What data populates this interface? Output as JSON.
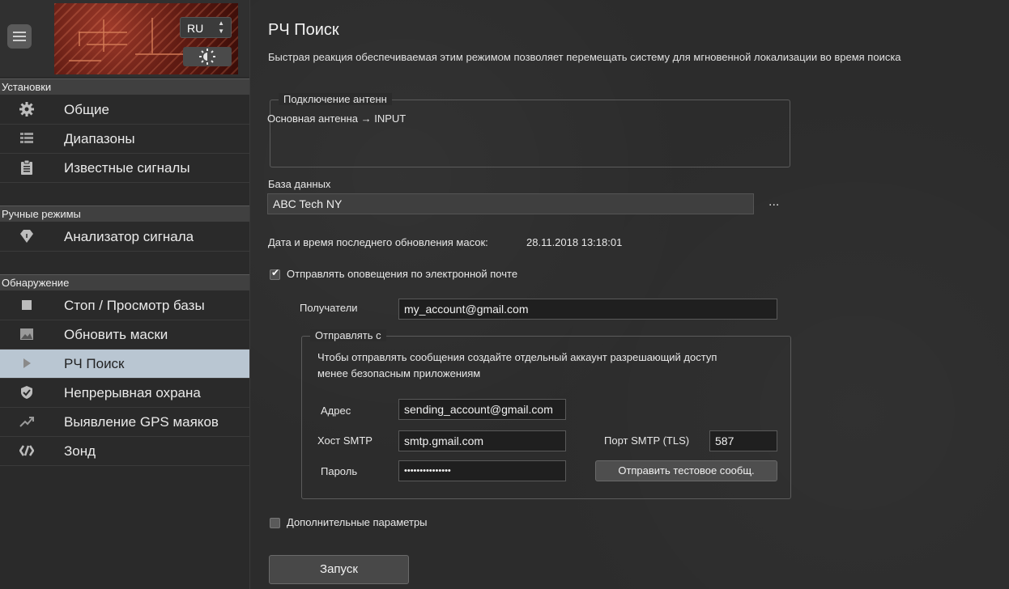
{
  "sidebar": {
    "lang": "RU",
    "sections": [
      {
        "title": "Установки"
      },
      {
        "title": "Ручные режимы"
      },
      {
        "title": "Обнаружение"
      }
    ],
    "items": [
      {
        "label": "Общие",
        "icon": "gear-icon"
      },
      {
        "label": "Диапазоны",
        "icon": "list-icon"
      },
      {
        "label": "Известные сигналы",
        "icon": "clipboard-icon"
      },
      {
        "label": "Анализатор сигнала",
        "icon": "diamond-icon"
      },
      {
        "label": "Стоп / Просмотр базы",
        "icon": "stop-icon"
      },
      {
        "label": "Обновить маски",
        "icon": "image-icon"
      },
      {
        "label": "РЧ Поиск",
        "icon": "play-icon",
        "active": true
      },
      {
        "label": "Непрерывная охрана",
        "icon": "shield-check-icon"
      },
      {
        "label": "Выявление GPS маяков",
        "icon": "trend-icon"
      },
      {
        "label": "Зонд",
        "icon": "code-icon"
      }
    ]
  },
  "main": {
    "title": "РЧ Поиск",
    "description": "Быстрая реакция обеспечиваемая этим режимом позволяет перемещать систему для мгновенной локализации во время поиска",
    "antenna": {
      "legend": "Подключение антенн",
      "text": "Основная антенна → INPUT"
    },
    "database": {
      "label": "База данных",
      "value": "ABC Tech NY",
      "more": "..."
    },
    "last_update": {
      "label": "Дата и время последнего обновления масок:",
      "value": "28.11.2018 13:18:01"
    },
    "email_notify": {
      "label": "Отправлять оповещения по электронной почте",
      "checked": true
    },
    "recipients": {
      "label": "Получатели",
      "value": "my_account@gmail.com"
    },
    "send_from": {
      "legend": "Отправлять с",
      "note_line1": "Чтобы отправлять сообщения создайте отдельный аккаунт разрешающий доступ",
      "note_line2": "менее безопасным приложениям",
      "address_label": "Адрес",
      "address_value": "sending_account@gmail.com",
      "smtp_host_label": "Хост SMTP",
      "smtp_host_value": "smtp.gmail.com",
      "smtp_port_label": "Порт SMTP (TLS)",
      "smtp_port_value": "587",
      "password_label": "Пароль",
      "password_value": "•••••••••••••••",
      "test_button": "Отправить тестовое сообщ."
    },
    "extra_params": {
      "label": "Дополнительные параметры",
      "checked": false
    },
    "start_button": "Запуск"
  }
}
